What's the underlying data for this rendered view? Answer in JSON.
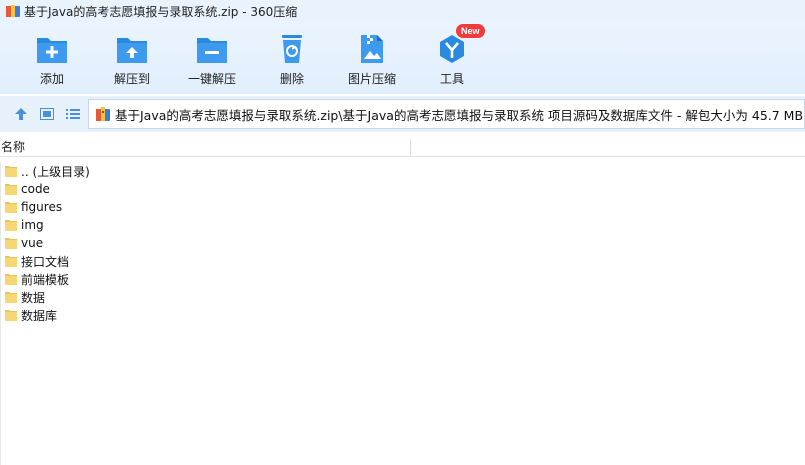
{
  "window": {
    "title": "基于Java的高考志愿填报与录取系统.zip - 360压缩"
  },
  "toolbar": {
    "items": [
      {
        "label": "添加",
        "icon": "add-folder-icon"
      },
      {
        "label": "解压到",
        "icon": "extract-to-icon"
      },
      {
        "label": "一键解压",
        "icon": "one-click-extract-icon"
      },
      {
        "label": "删除",
        "icon": "delete-icon"
      },
      {
        "label": "图片压缩",
        "icon": "image-compress-icon"
      },
      {
        "label": "工具",
        "icon": "tools-icon",
        "badge": "New"
      }
    ]
  },
  "navbar": {
    "path": "基于Java的高考志愿填报与录取系统.zip\\基于Java的高考志愿填报与录取系统 项目源码及数据库文件 - 解包大小为 45.7 MB"
  },
  "list": {
    "column_name": "名称",
    "items": [
      ".. (上级目录)",
      "code",
      "figures",
      "img",
      "vue",
      "接口文档",
      "前端模板",
      "数据",
      "数据库"
    ]
  },
  "colors": {
    "accent": "#2d8fe0",
    "toolbar_bg": "#e4f0fc",
    "folder": "#f7d774"
  }
}
